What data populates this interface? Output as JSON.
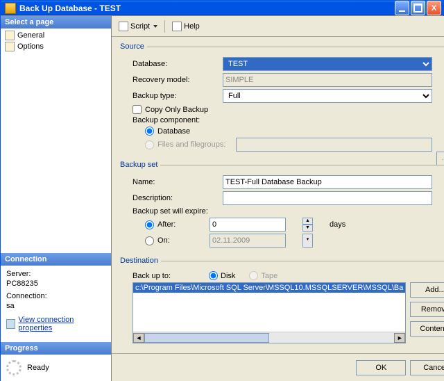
{
  "title": "Back Up Database - TEST",
  "left": {
    "select_page": "Select a page",
    "nav": [
      "General",
      "Options"
    ],
    "connection_head": "Connection",
    "server_label": "Server:",
    "server_value": "PC88235",
    "connection_label": "Connection:",
    "connection_value": "sa",
    "view_conn_link": "View connection properties",
    "progress_head": "Progress",
    "progress_status": "Ready"
  },
  "toolbar": {
    "script": "Script",
    "help": "Help"
  },
  "source": {
    "legend": "Source",
    "database_label": "Database:",
    "database_value": "TEST",
    "recovery_label": "Recovery model:",
    "recovery_value": "SIMPLE",
    "backup_type_label": "Backup type:",
    "backup_type_value": "Full",
    "copy_only": "Copy Only Backup",
    "component_label": "Backup component:",
    "radio_database": "Database",
    "radio_files": "Files and filegroups:"
  },
  "set": {
    "legend": "Backup set",
    "name_label": "Name:",
    "name_value": "TEST-Full Database Backup",
    "desc_label": "Description:",
    "desc_value": "",
    "expire_label": "Backup set will expire:",
    "after_label": "After:",
    "after_value": "0",
    "after_unit": "days",
    "on_label": "On:",
    "on_value": "02.11.2009"
  },
  "dest": {
    "legend": "Destination",
    "backup_to": "Back up to:",
    "disk": "Disk",
    "tape": "Tape",
    "selected_path": "c:\\Program Files\\Microsoft SQL Server\\MSSQL10.MSSQLSERVER\\MSSQL\\Ba",
    "add_btn": "Add...",
    "remove_btn": "Remove",
    "contents_btn": "Contents"
  },
  "footer": {
    "ok": "OK",
    "cancel": "Cancel"
  }
}
